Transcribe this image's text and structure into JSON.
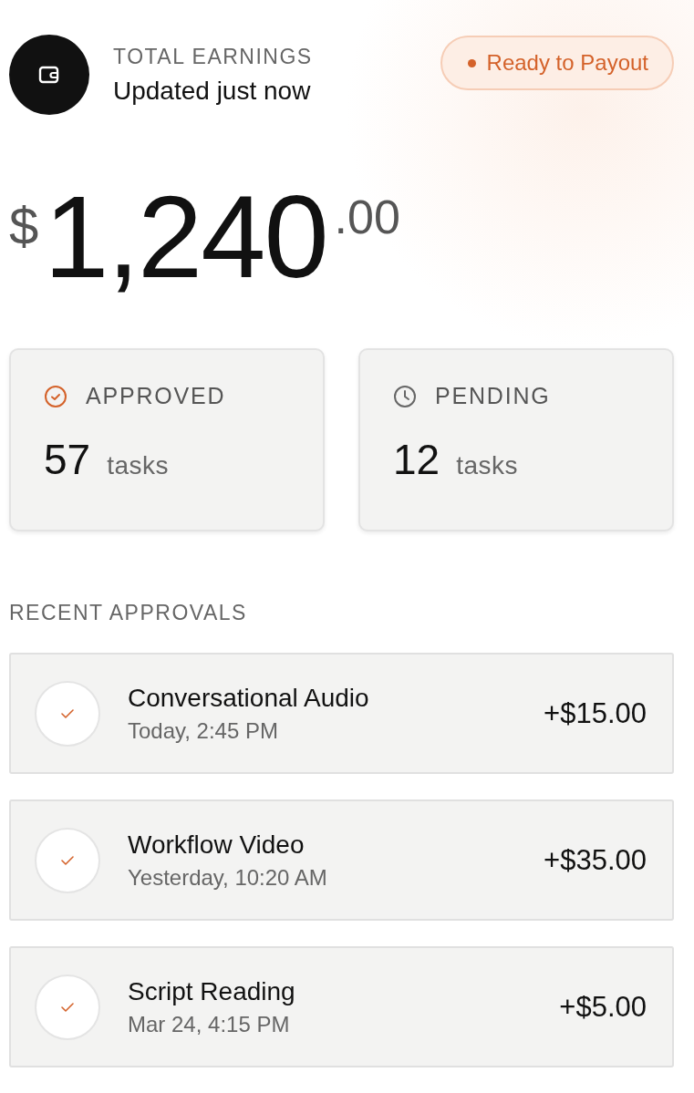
{
  "header": {
    "label": "TOTAL EARNINGS",
    "subtitle": "Updated just now",
    "status": "Ready to Payout"
  },
  "balance": {
    "currency": "$",
    "whole": "1,240",
    "cents": ".00"
  },
  "stats": [
    {
      "kind": "approved",
      "label": "APPROVED",
      "count": "57",
      "unit": "tasks"
    },
    {
      "kind": "pending",
      "label": "PENDING",
      "count": "12",
      "unit": "tasks"
    }
  ],
  "recent": {
    "title": "RECENT APPROVALS",
    "items": [
      {
        "name": "Conversational Audio",
        "time": "Today, 2:45 PM",
        "amount": "+$15.00"
      },
      {
        "name": "Workflow Video",
        "time": "Yesterday, 10:20 AM",
        "amount": "+$35.00"
      },
      {
        "name": "Script Reading",
        "time": "Mar 24, 4:15 PM",
        "amount": "+$5.00"
      }
    ]
  }
}
